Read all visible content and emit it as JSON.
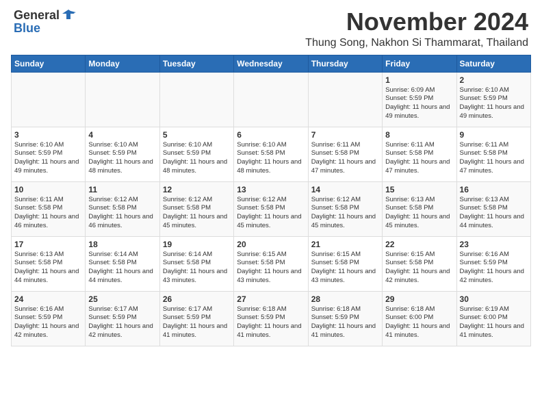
{
  "header": {
    "logo_general": "General",
    "logo_blue": "Blue",
    "month": "November 2024",
    "location": "Thung Song, Nakhon Si Thammarat, Thailand"
  },
  "weekdays": [
    "Sunday",
    "Monday",
    "Tuesday",
    "Wednesday",
    "Thursday",
    "Friday",
    "Saturday"
  ],
  "weeks": [
    [
      {
        "day": "",
        "info": ""
      },
      {
        "day": "",
        "info": ""
      },
      {
        "day": "",
        "info": ""
      },
      {
        "day": "",
        "info": ""
      },
      {
        "day": "",
        "info": ""
      },
      {
        "day": "1",
        "info": "Sunrise: 6:09 AM\nSunset: 5:59 PM\nDaylight: 11 hours and 49 minutes."
      },
      {
        "day": "2",
        "info": "Sunrise: 6:10 AM\nSunset: 5:59 PM\nDaylight: 11 hours and 49 minutes."
      }
    ],
    [
      {
        "day": "3",
        "info": "Sunrise: 6:10 AM\nSunset: 5:59 PM\nDaylight: 11 hours and 49 minutes."
      },
      {
        "day": "4",
        "info": "Sunrise: 6:10 AM\nSunset: 5:59 PM\nDaylight: 11 hours and 48 minutes."
      },
      {
        "day": "5",
        "info": "Sunrise: 6:10 AM\nSunset: 5:59 PM\nDaylight: 11 hours and 48 minutes."
      },
      {
        "day": "6",
        "info": "Sunrise: 6:10 AM\nSunset: 5:58 PM\nDaylight: 11 hours and 48 minutes."
      },
      {
        "day": "7",
        "info": "Sunrise: 6:11 AM\nSunset: 5:58 PM\nDaylight: 11 hours and 47 minutes."
      },
      {
        "day": "8",
        "info": "Sunrise: 6:11 AM\nSunset: 5:58 PM\nDaylight: 11 hours and 47 minutes."
      },
      {
        "day": "9",
        "info": "Sunrise: 6:11 AM\nSunset: 5:58 PM\nDaylight: 11 hours and 47 minutes."
      }
    ],
    [
      {
        "day": "10",
        "info": "Sunrise: 6:11 AM\nSunset: 5:58 PM\nDaylight: 11 hours and 46 minutes."
      },
      {
        "day": "11",
        "info": "Sunrise: 6:12 AM\nSunset: 5:58 PM\nDaylight: 11 hours and 46 minutes."
      },
      {
        "day": "12",
        "info": "Sunrise: 6:12 AM\nSunset: 5:58 PM\nDaylight: 11 hours and 45 minutes."
      },
      {
        "day": "13",
        "info": "Sunrise: 6:12 AM\nSunset: 5:58 PM\nDaylight: 11 hours and 45 minutes."
      },
      {
        "day": "14",
        "info": "Sunrise: 6:12 AM\nSunset: 5:58 PM\nDaylight: 11 hours and 45 minutes."
      },
      {
        "day": "15",
        "info": "Sunrise: 6:13 AM\nSunset: 5:58 PM\nDaylight: 11 hours and 45 minutes."
      },
      {
        "day": "16",
        "info": "Sunrise: 6:13 AM\nSunset: 5:58 PM\nDaylight: 11 hours and 44 minutes."
      }
    ],
    [
      {
        "day": "17",
        "info": "Sunrise: 6:13 AM\nSunset: 5:58 PM\nDaylight: 11 hours and 44 minutes."
      },
      {
        "day": "18",
        "info": "Sunrise: 6:14 AM\nSunset: 5:58 PM\nDaylight: 11 hours and 44 minutes."
      },
      {
        "day": "19",
        "info": "Sunrise: 6:14 AM\nSunset: 5:58 PM\nDaylight: 11 hours and 43 minutes."
      },
      {
        "day": "20",
        "info": "Sunrise: 6:15 AM\nSunset: 5:58 PM\nDaylight: 11 hours and 43 minutes."
      },
      {
        "day": "21",
        "info": "Sunrise: 6:15 AM\nSunset: 5:58 PM\nDaylight: 11 hours and 43 minutes."
      },
      {
        "day": "22",
        "info": "Sunrise: 6:15 AM\nSunset: 5:58 PM\nDaylight: 11 hours and 42 minutes."
      },
      {
        "day": "23",
        "info": "Sunrise: 6:16 AM\nSunset: 5:59 PM\nDaylight: 11 hours and 42 minutes."
      }
    ],
    [
      {
        "day": "24",
        "info": "Sunrise: 6:16 AM\nSunset: 5:59 PM\nDaylight: 11 hours and 42 minutes."
      },
      {
        "day": "25",
        "info": "Sunrise: 6:17 AM\nSunset: 5:59 PM\nDaylight: 11 hours and 42 minutes."
      },
      {
        "day": "26",
        "info": "Sunrise: 6:17 AM\nSunset: 5:59 PM\nDaylight: 11 hours and 41 minutes."
      },
      {
        "day": "27",
        "info": "Sunrise: 6:18 AM\nSunset: 5:59 PM\nDaylight: 11 hours and 41 minutes."
      },
      {
        "day": "28",
        "info": "Sunrise: 6:18 AM\nSunset: 5:59 PM\nDaylight: 11 hours and 41 minutes."
      },
      {
        "day": "29",
        "info": "Sunrise: 6:18 AM\nSunset: 6:00 PM\nDaylight: 11 hours and 41 minutes."
      },
      {
        "day": "30",
        "info": "Sunrise: 6:19 AM\nSunset: 6:00 PM\nDaylight: 11 hours and 41 minutes."
      }
    ]
  ]
}
